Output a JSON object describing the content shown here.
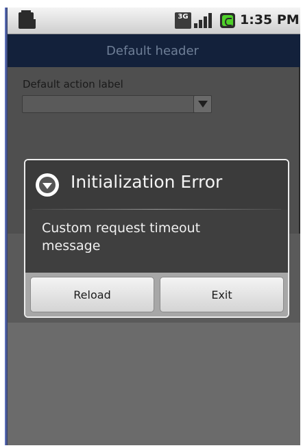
{
  "status_bar": {
    "time": "1:35 PM",
    "network_label": "3G",
    "icons": [
      "sd-card-icon",
      "3g-icon",
      "signal-icon",
      "battery-icon"
    ]
  },
  "header": {
    "title": "Default header"
  },
  "content": {
    "action_label": "Default action label",
    "spinner_value": ""
  },
  "dialog": {
    "title": "Initialization Error",
    "message": "Custom request timeout message",
    "buttons": {
      "reload": "Reload",
      "exit": "Exit"
    }
  },
  "colors": {
    "header_bg": "#13213b",
    "header_text": "#6f7f97",
    "dialog_bg": "#3f3f3f",
    "dialog_footer": "#a7a7a7"
  }
}
